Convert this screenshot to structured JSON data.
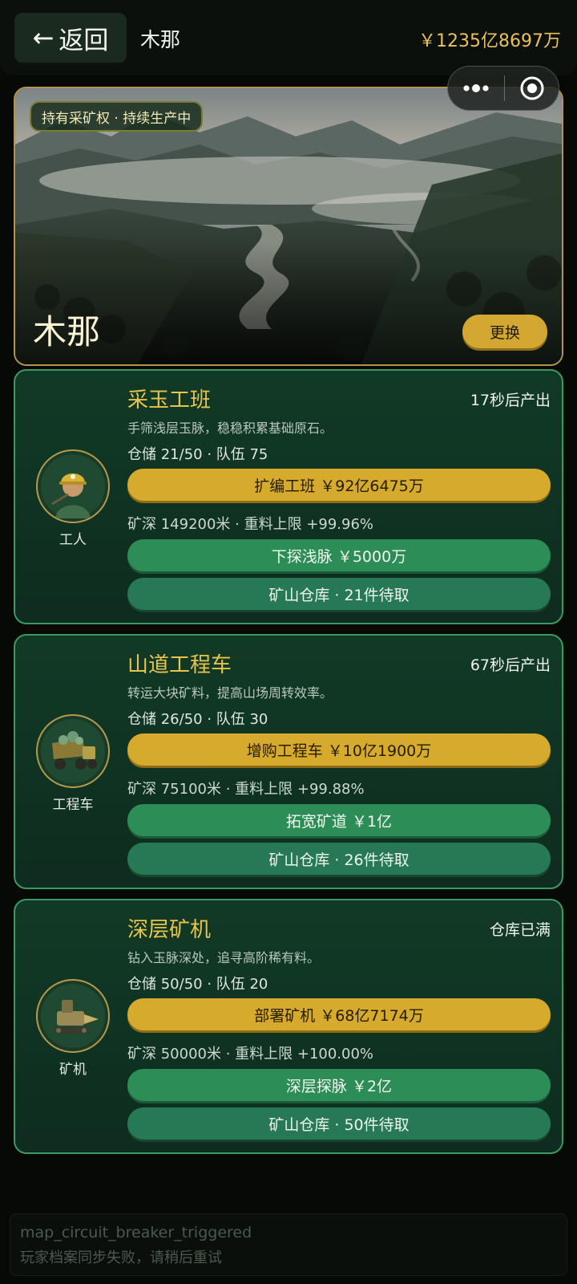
{
  "header": {
    "back_label": "返回",
    "title": "木那",
    "balance": "￥1235亿8697万"
  },
  "hero": {
    "badge": "持有采矿权 · 持续生产中",
    "mine_name": "木那",
    "change_label": "更换"
  },
  "cards": [
    {
      "title": "采玉工班",
      "timer": "17秒后产出",
      "desc": "手筛浅层玉脉，稳稳积累基础原石。",
      "stats": "仓储 21/50 · 队伍 75",
      "upgrade_label": "扩编工班 ￥92亿6475万",
      "depth": "矿深 149200米 · 重料上限 +99.96%",
      "explore_label": "下探浅脉 ￥5000万",
      "storage_label": "矿山仓库 · 21件待取",
      "avatar_label": "工人",
      "avatar_icon": "miner-icon"
    },
    {
      "title": "山道工程车",
      "timer": "67秒后产出",
      "desc": "转运大块矿料，提高山场周转效率。",
      "stats": "仓储 26/50 · 队伍 30",
      "upgrade_label": "增购工程车 ￥10亿1900万",
      "depth": "矿深 75100米 · 重料上限 +99.88%",
      "explore_label": "拓宽矿道 ￥1亿",
      "storage_label": "矿山仓库 · 26件待取",
      "avatar_label": "工程车",
      "avatar_icon": "dump-truck-icon"
    },
    {
      "title": "深层矿机",
      "timer": "仓库已满",
      "desc": "钻入玉脉深处，追寻高阶稀有料。",
      "stats": "仓储 50/50 · 队伍 20",
      "upgrade_label": "部署矿机 ￥68亿7174万",
      "depth": "矿深 50000米 · 重料上限 +100.00%",
      "explore_label": "深层探脉 ￥2亿",
      "storage_label": "矿山仓库 · 50件待取",
      "avatar_label": "矿机",
      "avatar_icon": "drill-machine-icon"
    }
  ],
  "error": {
    "code": "map_circuit_breaker_triggered",
    "message": "玩家档案同步失败，请稍后重试"
  }
}
